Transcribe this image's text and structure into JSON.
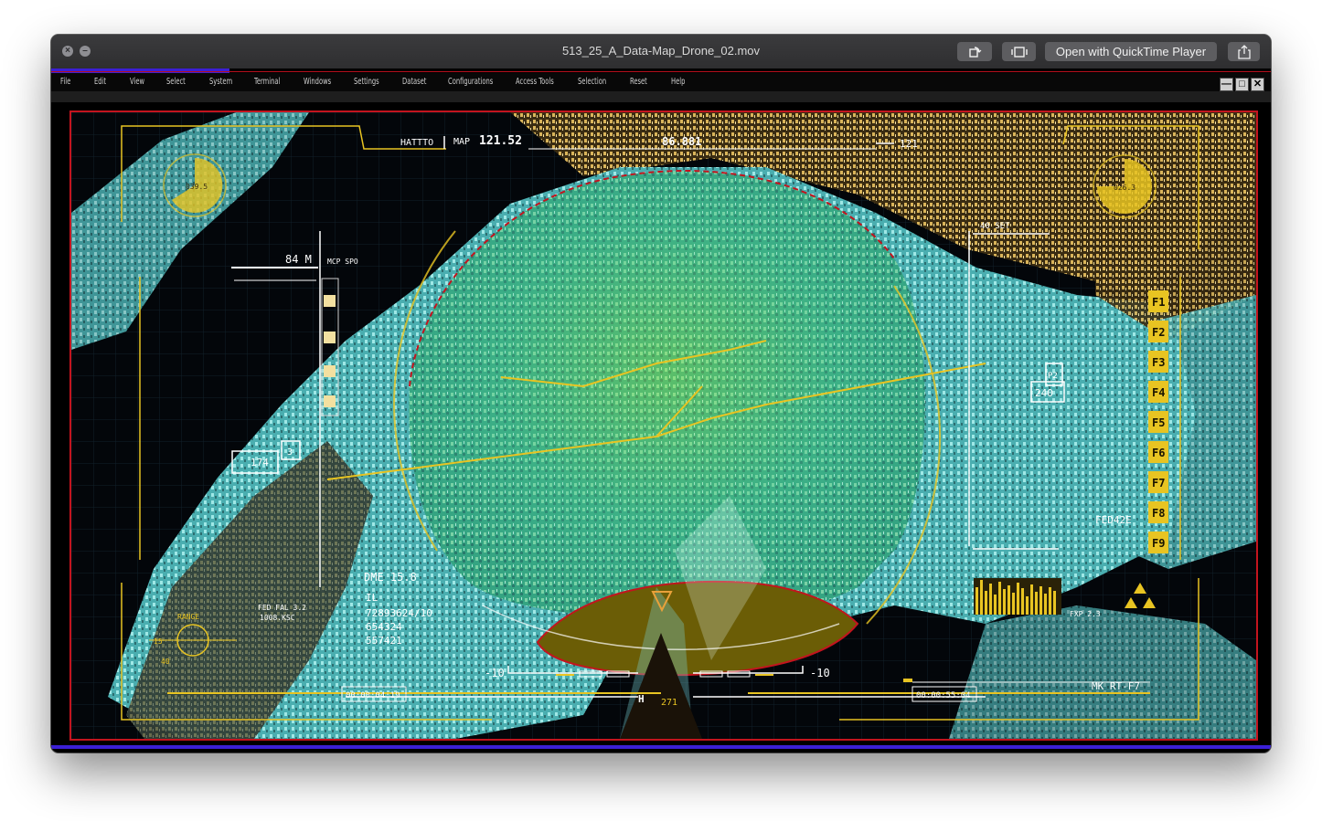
{
  "window": {
    "title": "513_25_A_Data-Map_Drone_02.mov",
    "open_with_label": "Open with QuickTime Player",
    "close_glyph": "×",
    "minimize_glyph": "–",
    "share_icon": "share-icon",
    "rotate_icon": "rotate-icon",
    "trim_icon": "trim-icon"
  },
  "menu": {
    "items": [
      "File",
      "Edit",
      "View",
      "Select",
      "System",
      "Terminal",
      "Windows",
      "Settings",
      "Dataset",
      "Configurations",
      "Access Tools",
      "Selection",
      "Reset",
      "Help"
    ]
  },
  "window_controls": {
    "minimize": "—",
    "maximize": "□",
    "close": "✕"
  },
  "hud": {
    "left_dial": "039.5",
    "right_dial": "026.3",
    "hatt_label": "HATTTO",
    "map_label": "MAP",
    "map_value": "121.52",
    "center_value": "86.881",
    "top_right_value": "121",
    "altitude_value": "84 M",
    "mcp_label": "MCP SPO",
    "side_box_value": "174",
    "side_box_small": "3",
    "dme_label": "DME 15.8",
    "il_label": "IL",
    "code_lines": [
      "72893624/10",
      "654324",
      "557421"
    ],
    "fed_label": "FED FAL 3.2",
    "fed_sub": "1008.KSC",
    "range_label": "RANGE",
    "left_small": "40",
    "left_small2": "15",
    "set_label": "40 SET",
    "right_box_value": "240",
    "right_box_small": "P2",
    "fed_code": "FED42E",
    "fxp_label": "FXP 2.3",
    "fkeys": [
      "F1",
      "F2",
      "F3",
      "F4",
      "F5",
      "F6",
      "F7",
      "F8",
      "F9"
    ],
    "scale_left": "-10",
    "scale_right": "-10",
    "heading_letter": "H",
    "heading_value": "271",
    "timecode_left": "00:00:04:19",
    "timecode_right": "00:00:55:04",
    "mk_label": "MK RT-F7"
  },
  "colors": {
    "hud_yellow": "#e8c422",
    "viewport_border": "#c3141e",
    "accent_blue": "#3b1fd6",
    "map_cyan": "#5ec9c8",
    "map_green": "#3fbf5a",
    "city_gold": "#d9b45a",
    "olive_zone": "#6b5d06"
  }
}
